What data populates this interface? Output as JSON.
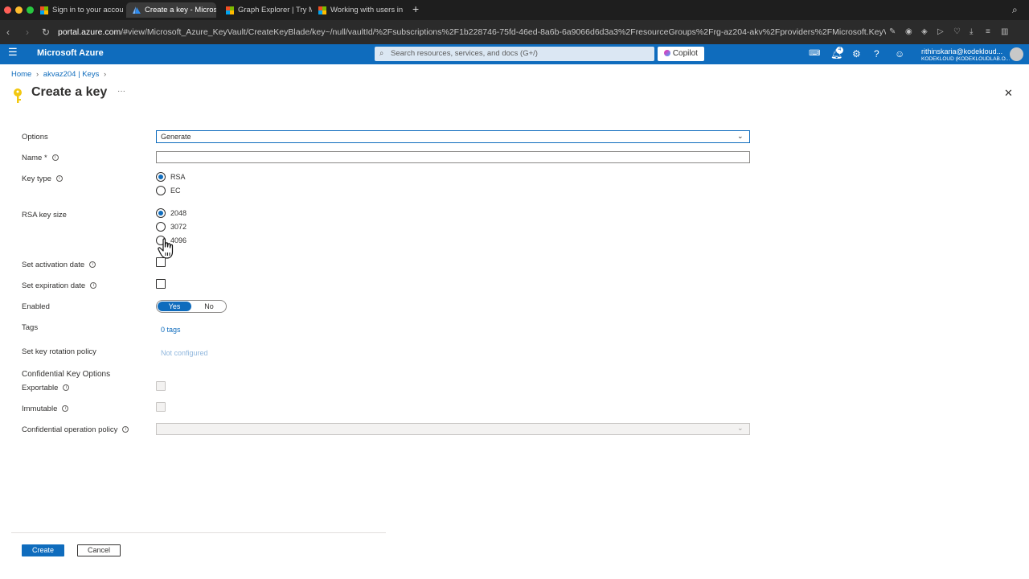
{
  "browser": {
    "tabs": [
      {
        "title": "Sign in to your account",
        "icon": "microsoft-logo",
        "active": false
      },
      {
        "title": "Create a key - Microsoft",
        "icon": "azure-logo",
        "active": true
      },
      {
        "title": "Graph Explorer | Try Mic",
        "icon": "microsoft-logo",
        "active": false
      },
      {
        "title": "Working with users in M",
        "icon": "microsoft-logo",
        "active": false
      }
    ],
    "url_host": "portal.azure.com",
    "url_path": "/#view/Microsoft_Azure_KeyVault/CreateKeyBlade/key~/null/vaultId/%2Fsubscriptions%2F1b228746-75fd-46ed-8a6b-6a9066d6d3a3%2FresourceGroups%2Frg-az204-akv%2Fproviders%2FMicrosoft.KeyVault"
  },
  "azure_header": {
    "title": "Microsoft Azure",
    "search_placeholder": "Search resources, services, and docs (G+/)",
    "copilot_label": "Copilot",
    "notification_count": "4",
    "user_email": "rithinskaria@kodekloud...",
    "user_tenant": "KODEKLOUD (KODEKLOUDLAB.O..."
  },
  "breadcrumb": {
    "home": "Home",
    "vault": "akvaz204 | Keys"
  },
  "page": {
    "title": "Create a key",
    "more": "···",
    "close": "✕"
  },
  "form": {
    "options_label": "Options",
    "options_value": "Generate",
    "name_label": "Name *",
    "name_value": "",
    "key_type_label": "Key type",
    "key_types": [
      "RSA",
      "EC"
    ],
    "key_type_selected": "RSA",
    "rsa_size_label": "RSA key size",
    "rsa_sizes": [
      "2048",
      "3072",
      "4096"
    ],
    "rsa_size_selected": "2048",
    "activation_label": "Set activation date",
    "expiration_label": "Set expiration date",
    "enabled_label": "Enabled",
    "enabled_yes": "Yes",
    "enabled_no": "No",
    "enabled_selected": "Yes",
    "tags_label": "Tags",
    "tags_value": "0 tags",
    "rotation_label": "Set key rotation policy",
    "rotation_value": "Not configured",
    "confidential_heading": "Confidential Key Options",
    "exportable_label": "Exportable",
    "immutable_label": "Immutable",
    "policy_label": "Confidential operation policy"
  },
  "footer": {
    "create": "Create",
    "cancel": "Cancel"
  },
  "colors": {
    "accent": "#0f6cbd",
    "header": "#0f6cbd"
  }
}
